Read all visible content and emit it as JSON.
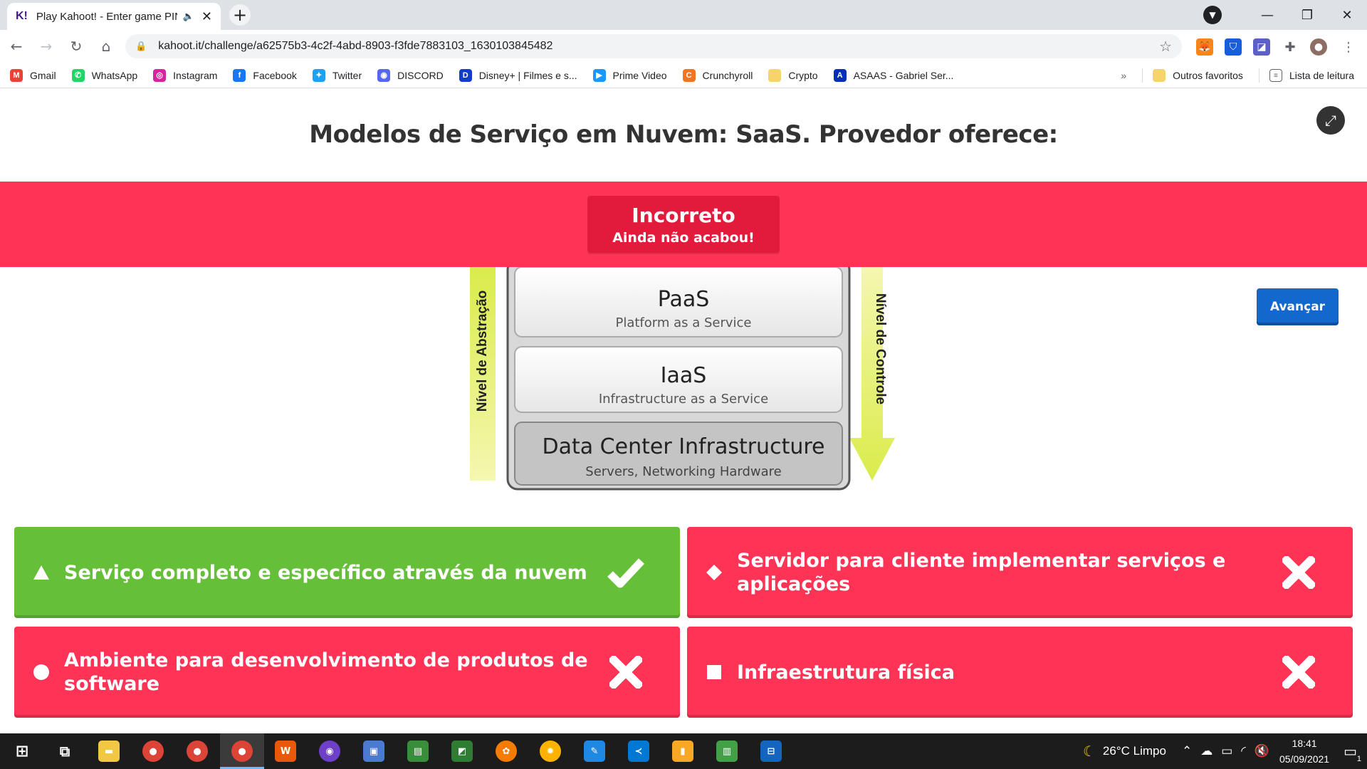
{
  "browser": {
    "tab_title": "Play Kahoot! - Enter game PIN",
    "tab_favicon": "K!",
    "url": "kahoot.it/challenge/a62575b3-4c2f-4abd-8903-f3fde7883103_1630103845482",
    "bookmarks": [
      {
        "label": "Gmail",
        "icon": "gmail-icon",
        "color": "#ea4335",
        "glyph": "M"
      },
      {
        "label": "WhatsApp",
        "icon": "whatsapp-icon",
        "color": "#25d366",
        "glyph": "✆"
      },
      {
        "label": "Instagram",
        "icon": "instagram-icon",
        "color": "#d6249f",
        "glyph": "◎"
      },
      {
        "label": "Facebook",
        "icon": "facebook-icon",
        "color": "#1877f2",
        "glyph": "f"
      },
      {
        "label": "Twitter",
        "icon": "twitter-icon",
        "color": "#1da1f2",
        "glyph": "✦"
      },
      {
        "label": "DISCORD",
        "icon": "discord-icon",
        "color": "#5865f2",
        "glyph": "◉"
      },
      {
        "label": "Disney+ | Filmes e s...",
        "icon": "disney-icon",
        "color": "#113ccf",
        "glyph": "D"
      },
      {
        "label": "Prime Video",
        "icon": "prime-video-icon",
        "color": "#1a98ff",
        "glyph": "▶"
      },
      {
        "label": "Crunchyroll",
        "icon": "crunchyroll-icon",
        "color": "#f47521",
        "glyph": "C"
      },
      {
        "label": "Crypto",
        "icon": "folder-icon",
        "color": "#f6d36b",
        "glyph": ""
      },
      {
        "label": "ASAAS - Gabriel Ser...",
        "icon": "asaas-icon",
        "color": "#0030b9",
        "glyph": "A"
      }
    ],
    "bookmarks_overflow": "»",
    "other_favorites": "Outros favoritos",
    "reading_list": "Lista de leitura"
  },
  "game": {
    "question": "Modelos de Serviço em Nuvem: SaaS. Provedor oferece:",
    "result_title": "Incorreto",
    "result_subtitle": "Ainda não acabou!",
    "advance_button": "Avançar",
    "answers": [
      {
        "text": "Serviço completo e específico através da nuvem",
        "shape": "triangle",
        "correct": true
      },
      {
        "text": "Servidor para cliente implementar serviços e aplicações",
        "shape": "diamond",
        "correct": false
      },
      {
        "text": "Ambiente para desenvolvimento de produtos de software",
        "shape": "circle",
        "correct": false
      },
      {
        "text": "Infraestrutura física",
        "shape": "square",
        "correct": false
      }
    ],
    "colors": {
      "correct": "#66bf39",
      "incorrect": "#ff3355",
      "banner": "#ff3355",
      "result_box": "#e21b3c",
      "advance": "#1368ce"
    }
  },
  "diagram": {
    "left_axis_label": "Nível de Abstração",
    "right_axis_label": "Nível de Controle",
    "layers": [
      {
        "title": "PaaS",
        "subtitle": "Platform as a Service"
      },
      {
        "title": "IaaS",
        "subtitle": "Infrastructure as a Service"
      },
      {
        "title": "Data Center Infrastructure",
        "subtitle": "Servers, Networking Hardware"
      }
    ]
  },
  "taskbar": {
    "weather": "26°C  Limpo",
    "time": "18:41",
    "date": "05/09/2021",
    "notification_count": "1"
  }
}
